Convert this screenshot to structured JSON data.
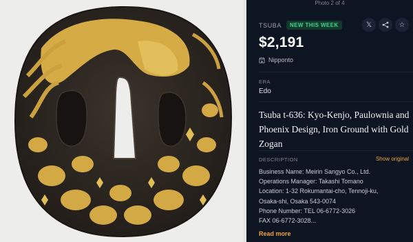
{
  "gallery": {
    "counter": "Photo 2 of 4"
  },
  "listing": {
    "category": "TSUBA",
    "badge": "NEW THIS WEEK",
    "price": "$2,191",
    "seller": "Nipponto",
    "era_label": "ERA",
    "era_value": "Edo",
    "title": "Tsuba t-636: Kyo-Kenjo, Paulownia and Phoenix Design, Iron Ground with Gold Zogan",
    "description_label": "DESCRIPTION",
    "show_original": "Show original",
    "description_lines": [
      "Business Name: Meirin Sangyo Co., Ltd.",
      "Operations Manager: Takashi Tomano",
      "Location: 1-32 Rokumantai-cho, Tennoji-ku,",
      "Osaka-shi, Osaka 543-0074",
      "Phone Number: TEL 06-6772-3026",
      "FAX 06-6772-3028..."
    ],
    "read_more": "Read more"
  },
  "actions": [
    {
      "name": "x-share-icon",
      "glyph": "𝕏"
    },
    {
      "name": "share-icon",
      "glyph": "⋰"
    },
    {
      "name": "star-icon",
      "glyph": "☆"
    }
  ],
  "colors": {
    "panel_bg": "#0d1523",
    "accent": "#f0a23a",
    "badge_text": "#3fd48e",
    "badge_bg": "#123a2c",
    "photo_bg": "#ededeb",
    "iron": "#2a2520",
    "gold": "#d9b24c"
  }
}
